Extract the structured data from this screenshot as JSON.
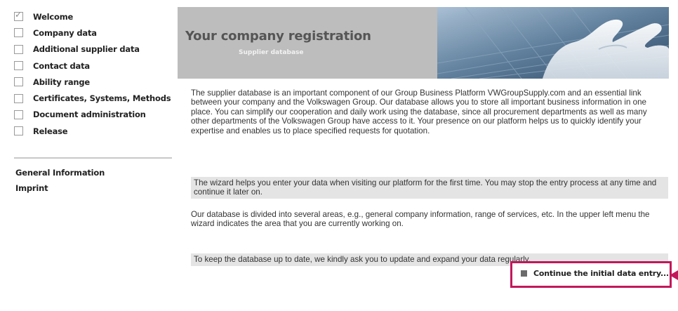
{
  "sidebar": {
    "items": [
      {
        "label": "Welcome",
        "checked": true
      },
      {
        "label": "Company data",
        "checked": false
      },
      {
        "label": "Additional supplier data",
        "checked": false
      },
      {
        "label": "Contact data",
        "checked": false
      },
      {
        "label": "Ability range",
        "checked": false
      },
      {
        "label": "Certificates, Systems, Methods",
        "checked": false
      },
      {
        "label": "Document administration",
        "checked": false
      },
      {
        "label": "Release",
        "checked": false
      }
    ],
    "links": {
      "general_information": "General Information",
      "imprint": "Imprint"
    }
  },
  "banner": {
    "title": "Your company registration",
    "subtitle": "Supplier database"
  },
  "content": {
    "p1": "The supplier database is an important component of our Group Business Platform VWGroupSupply.com and an essential link between your company and the Volkswagen Group. Our database allows you to store all important business information in one place. You can simplify our cooperation and daily work using the database, since all procurement departments as well as many other departments of the Volkswagen Group have access to it. Your presence on our platform helps us to quickly identify your expertise and enables us to place specified requests for quotation.",
    "p2": "The wizard helps you enter your data when visiting our platform for the first time. You may stop the entry process at any time and continue it later on.",
    "p3": "Our database is divided into several areas, e.g., general company information, range of services, etc. In the upper left menu the wizard indicates the area that you are currently working on.",
    "p4": "To keep the database up to date, we kindly ask you to update and expand your data regularly."
  },
  "actions": {
    "continue_label": "Continue the initial data entry..."
  },
  "colors": {
    "highlight_border": "#c2185b",
    "banner_bg": "#bdbdbd",
    "shaded_paragraph_bg": "#e4e4e4"
  }
}
